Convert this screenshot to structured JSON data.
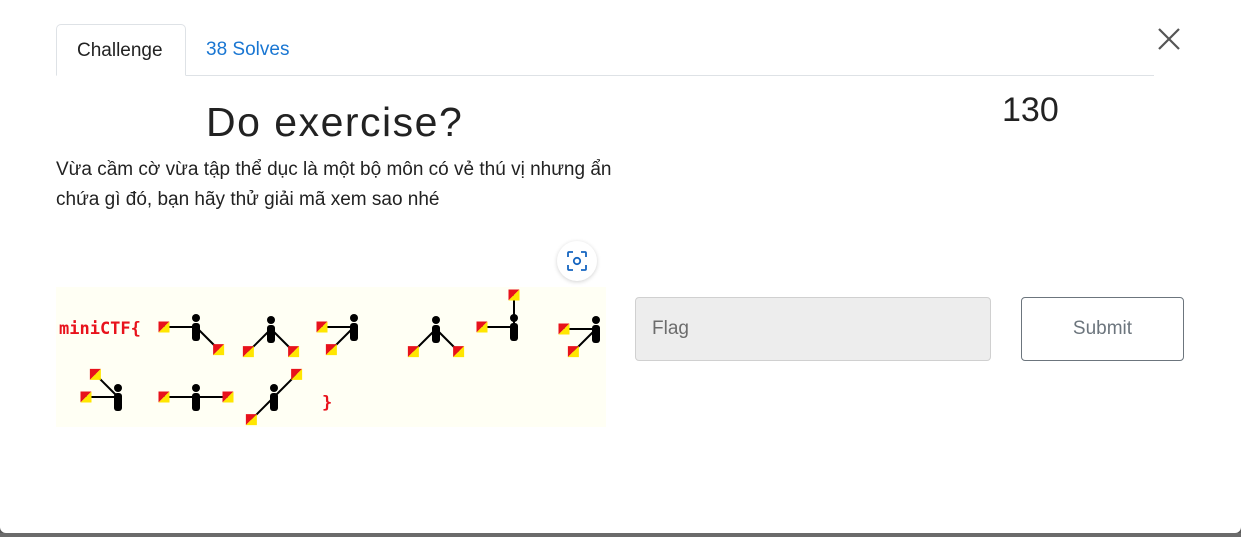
{
  "tabs": {
    "challenge_label": "Challenge",
    "solves_label": "38 Solves"
  },
  "challenge": {
    "title": "Do exercise?",
    "points": "130",
    "description": "Vừa cầm cờ vừa tập thể dục là một bộ môn có vẻ thú vị nhưng ẩn chứa gì đó, bạn hãy thử giải mã xem sao nhé"
  },
  "image": {
    "prefix_text": "miniCTF{",
    "suffix_text": "}",
    "flag_colors": {
      "red": "#e8121b",
      "yellow": "#ffe600"
    },
    "text_color": "#e8121b"
  },
  "form": {
    "flag_placeholder": "Flag",
    "flag_value": "",
    "submit_label": "Submit"
  },
  "icons": {
    "close": "close-icon",
    "zoom": "zoom-icon"
  },
  "colors": {
    "link": "#1976d2",
    "input_bg": "#ededed",
    "button_border": "#6c757d"
  }
}
